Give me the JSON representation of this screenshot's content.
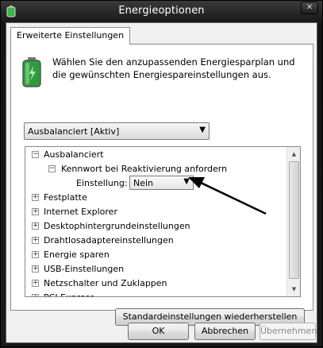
{
  "window": {
    "title": "Energieoptionen",
    "close_glyph": "✕"
  },
  "tab": {
    "label": "Erweiterte Einstellungen"
  },
  "intro_text": "Wählen Sie den anzupassenden Energiesparplan und die gewünschten Energiespareinstellungen aus.",
  "plan_select": {
    "value": "Ausbalanciert [Aktiv]"
  },
  "tree": {
    "root": {
      "label": "Ausbalanciert",
      "toggle": "−"
    },
    "child": {
      "label": "Kennwort bei Reaktivierung anfordern",
      "toggle": "−"
    },
    "setting": {
      "label": "Einstellung:",
      "value": "Nein"
    },
    "items": [
      {
        "label": "Festplatte",
        "toggle": "+"
      },
      {
        "label": "Internet Explorer",
        "toggle": "+"
      },
      {
        "label": "Desktophintergrundeinstellungen",
        "toggle": "+"
      },
      {
        "label": "Drahtlosadaptereinstellungen",
        "toggle": "+"
      },
      {
        "label": "Energie sparen",
        "toggle": "+"
      },
      {
        "label": "USB-Einstellungen",
        "toggle": "+"
      },
      {
        "label": "Netzschalter und Zuklappen",
        "toggle": "+"
      },
      {
        "label": "PCI Express",
        "toggle": "+"
      }
    ]
  },
  "buttons": {
    "restore": "Standardeinstellungen wiederherstellen",
    "ok": "OK",
    "cancel": "Abbrechen",
    "apply": "Übernehmen"
  },
  "icons": {
    "app": "battery-plug-icon",
    "header": "battery-icon",
    "dropdown": "chevron-down-icon",
    "annotation": "arrow-annotation"
  },
  "colors": {
    "title_bar": "#1a1a1a",
    "battery_green": "#3bb54a"
  }
}
